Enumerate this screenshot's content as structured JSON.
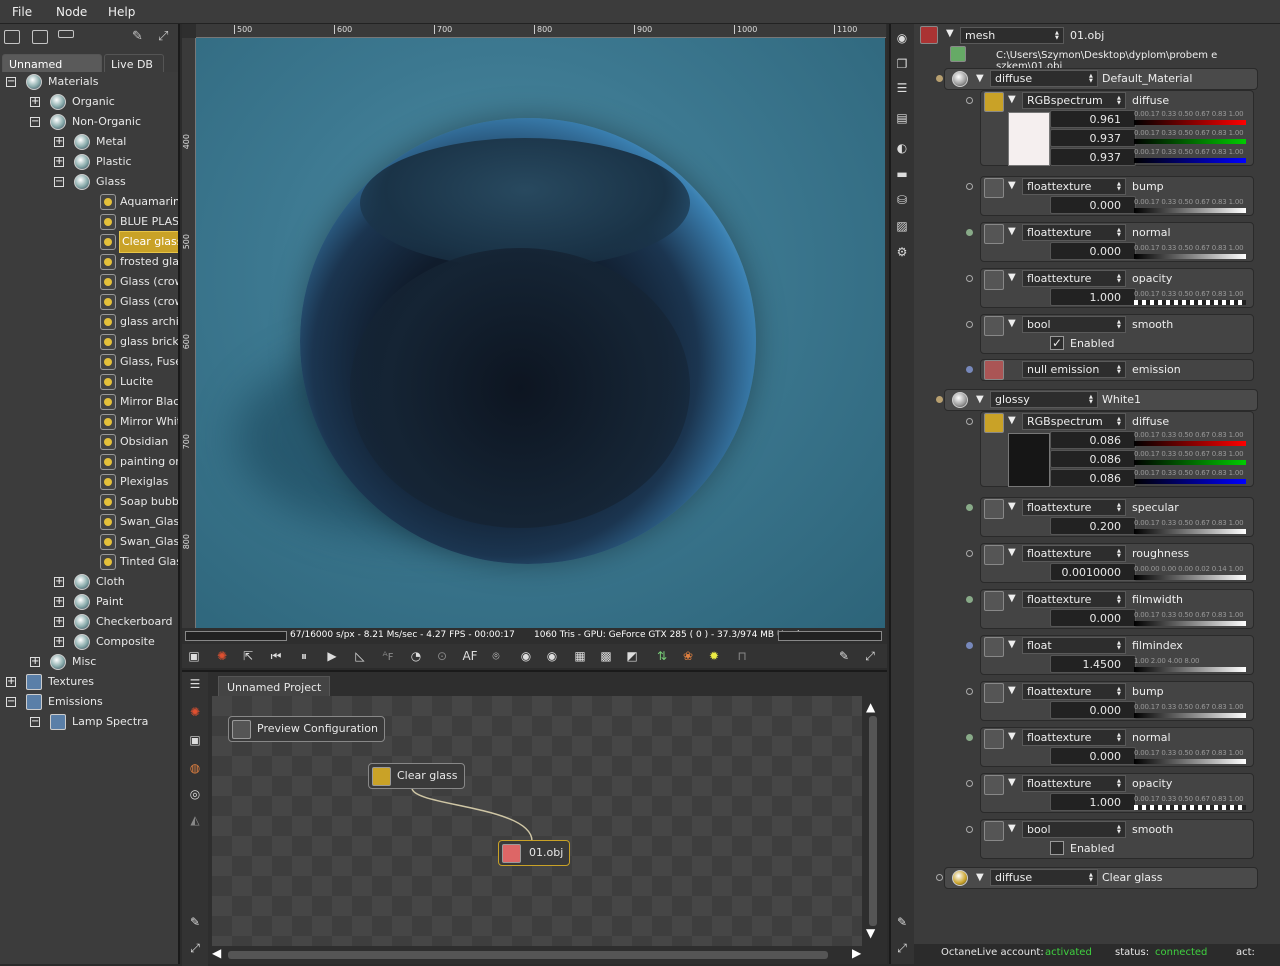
{
  "menu": [
    "File",
    "Node",
    "Help"
  ],
  "left_panel": {
    "tabs": [
      "Unnamed Project",
      "Live DB"
    ],
    "tree": [
      {
        "label": "Materials",
        "level": 0,
        "expander": "−",
        "icon": "sphere"
      },
      {
        "label": "Organic",
        "level": 1,
        "expander": "+",
        "icon": "sphere"
      },
      {
        "label": "Non-Organic",
        "level": 1,
        "expander": "−",
        "icon": "sphere"
      },
      {
        "label": "Metal",
        "level": 2,
        "expander": "+",
        "icon": "sphere"
      },
      {
        "label": "Plastic",
        "level": 2,
        "expander": "+",
        "icon": "sphere"
      },
      {
        "label": "Glass",
        "level": 2,
        "expander": "−",
        "icon": "sphere"
      },
      {
        "label": "Aquamarin r",
        "level": 3,
        "icon": "material"
      },
      {
        "label": "BLUE PLAST",
        "level": 3,
        "icon": "material"
      },
      {
        "label": "Clear glass",
        "level": 3,
        "icon": "material",
        "selected": true
      },
      {
        "label": "frosted glass",
        "level": 3,
        "icon": "material"
      },
      {
        "label": "Glass (crown",
        "level": 3,
        "icon": "material"
      },
      {
        "label": "Glass (crown",
        "level": 3,
        "icon": "material"
      },
      {
        "label": "glass archite",
        "level": 3,
        "icon": "material"
      },
      {
        "label": "glass brick",
        "level": 3,
        "icon": "material"
      },
      {
        "label": "Glass, Fusec",
        "level": 3,
        "icon": "material"
      },
      {
        "label": "Lucite",
        "level": 3,
        "icon": "material"
      },
      {
        "label": "Mirror Black",
        "level": 3,
        "icon": "material"
      },
      {
        "label": "Mirror White",
        "level": 3,
        "icon": "material"
      },
      {
        "label": "Obsidian",
        "level": 3,
        "icon": "material"
      },
      {
        "label": "painting on",
        "level": 3,
        "icon": "material"
      },
      {
        "label": "Plexiglas",
        "level": 3,
        "icon": "material"
      },
      {
        "label": "Soap bubble",
        "level": 3,
        "icon": "material"
      },
      {
        "label": "Swan_Glass",
        "level": 3,
        "icon": "material"
      },
      {
        "label": "Swan_Glass",
        "level": 3,
        "icon": "material"
      },
      {
        "label": "Tinted Glass",
        "level": 3,
        "icon": "material"
      },
      {
        "label": "Cloth",
        "level": 2,
        "expander": "+",
        "icon": "sphere"
      },
      {
        "label": "Paint",
        "level": 2,
        "expander": "+",
        "icon": "sphere"
      },
      {
        "label": "Checkerboard",
        "level": 2,
        "expander": "+",
        "icon": "sphere"
      },
      {
        "label": "Composite",
        "level": 2,
        "expander": "+",
        "icon": "sphere"
      },
      {
        "label": "Misc",
        "level": 1,
        "expander": "+",
        "icon": "sphere"
      },
      {
        "label": "Textures",
        "level": 0,
        "expander": "+",
        "icon": "folder"
      },
      {
        "label": "Emissions",
        "level": 0,
        "expander": "−",
        "icon": "folder"
      },
      {
        "label": "Lamp Spectra",
        "level": 1,
        "expander": "−",
        "icon": "folder"
      }
    ]
  },
  "viewport": {
    "ruler_top": [
      "500",
      "600",
      "700",
      "800",
      "900",
      "1000",
      "1100"
    ],
    "ruler_left": [
      "400",
      "500",
      "600",
      "700",
      "800"
    ],
    "status_left": "67/16000 s/px - 8.21 Ms/sec - 4.27 FPS - 00:00:17",
    "status_right": "1060 Tris - GPU: GeForce GTX 285 ( 0 ) - 37.3/974 MB Used",
    "toolbar_af": "AF"
  },
  "node_editor": {
    "tab": "Unnamed Project",
    "nodes": {
      "preview": "Preview Configuration",
      "material": "Clear glass",
      "mesh": "01.obj"
    }
  },
  "inspector": {
    "top_type": "mesh",
    "top_name": "01.obj",
    "path": "C:\\Users\\Szymon\\Desktop\\dyplom\\probem e szkem\\01.obj",
    "slider_scale": "0.00.17 0.33 0.50 0.67 0.83 1.00",
    "slider_scale_rough": "0.00.00 0.00 0.00 0.02 0.14 1.00",
    "slider_scale_index": "1.00     2.00     4.00     8.00",
    "mat1": {
      "type": "diffuse",
      "name": "Default_Material",
      "diffuse": {
        "tex": "RGBspectrum",
        "label": "diffuse",
        "r": "0.961",
        "g": "0.937",
        "b": "0.937",
        "swatch": "#f5efef"
      },
      "bump": {
        "tex": "floattexture",
        "label": "bump",
        "value": "0.000"
      },
      "normal": {
        "tex": "floattexture",
        "label": "normal",
        "value": "0.000"
      },
      "opacity": {
        "tex": "floattexture",
        "label": "opacity",
        "value": "1.000"
      },
      "smooth": {
        "tex": "bool",
        "label": "smooth",
        "check": "Enabled",
        "checked": true
      },
      "emission": {
        "tex": "null emission",
        "label": "emission"
      }
    },
    "mat2": {
      "type": "glossy",
      "name": "White1",
      "diffuse": {
        "tex": "RGBspectrum",
        "label": "diffuse",
        "r": "0.086",
        "g": "0.086",
        "b": "0.086",
        "swatch": "#161616"
      },
      "specular": {
        "tex": "floattexture",
        "label": "specular",
        "value": "0.200"
      },
      "roughness": {
        "tex": "floattexture",
        "label": "roughness",
        "value": "0.0010000"
      },
      "filmwidth": {
        "tex": "floattexture",
        "label": "filmwidth",
        "value": "0.000"
      },
      "filmindex": {
        "tex": "float",
        "label": "filmindex",
        "value": "1.4500"
      },
      "bump": {
        "tex": "floattexture",
        "label": "bump",
        "value": "0.000"
      },
      "normal": {
        "tex": "floattexture",
        "label": "normal",
        "value": "0.000"
      },
      "opacity": {
        "tex": "floattexture",
        "label": "opacity",
        "value": "1.000"
      },
      "smooth": {
        "tex": "bool",
        "label": "smooth",
        "check": "Enabled",
        "checked": false
      }
    },
    "mat3": {
      "type": "diffuse",
      "name": "Clear glass"
    }
  },
  "footer": {
    "account_label": "OctaneLive account:",
    "account_value": "activated",
    "status_label": "status:",
    "status_value": "connected",
    "act_label": "act:"
  },
  "colors": {
    "accent_green": "#3fd23f",
    "selection": "#c9a227"
  }
}
